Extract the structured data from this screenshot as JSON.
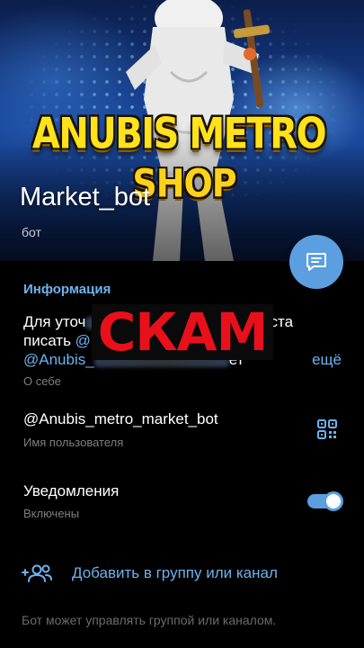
{
  "banner": {
    "logo_line1": "ANUBIS METRO",
    "logo_line2": "SHOP"
  },
  "profile": {
    "name": "Market_bot",
    "status": "бот"
  },
  "fab": {
    "icon": "message-icon"
  },
  "info": {
    "section_title": "Информация",
    "bio_line1_start": "Для уточ",
    "bio_line1_end": "-листа",
    "bio_line2_start": "писать ",
    "bio_line2_link": "@",
    "bio_line3_link": "@Anubis_",
    "bio_line3_end": "ет",
    "bio_more": "ещё",
    "bio_caption": "О себе",
    "overlay_stamp": "СКАМ",
    "username": "@Anubis_metro_market_bot",
    "username_caption": "Имя пользователя",
    "username_icon": "qr-code-icon",
    "notifications_label": "Уведомления",
    "notifications_state": "Включены",
    "notifications_enabled": true,
    "add_to_group": "Добавить в группу или канал",
    "add_to_group_icon": "add-users-icon",
    "footer_note": "Бот может управлять группой или каналом."
  },
  "colors": {
    "accent": "#6cb2ef",
    "fab": "#5b9fe0",
    "stamp": "#e8101b",
    "logo": "#ffe21a",
    "background": "#000000"
  }
}
